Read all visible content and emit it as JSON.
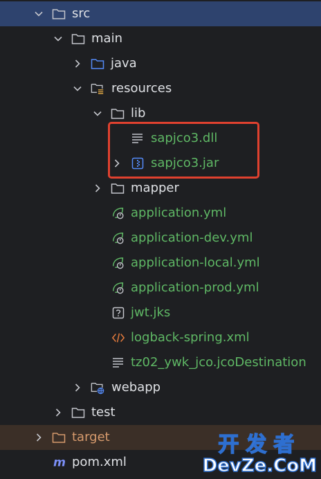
{
  "tree": {
    "src": "src",
    "main": "main",
    "java": "java",
    "resources": "resources",
    "lib": "lib",
    "dll": "sapjco3.dll",
    "jar": "sapjco3.jar",
    "mapper": "mapper",
    "app_yml": "application.yml",
    "app_dev": "application-dev.yml",
    "app_local": "application-local.yml",
    "app_prod": "application-prod.yml",
    "jwt": "jwt.jks",
    "logback": "logback-spring.xml",
    "jco_dest": "tz02_ywk_jco.jcoDestination",
    "webapp": "webapp",
    "test": "test",
    "target": "target",
    "pom": "pom.xml"
  },
  "watermark": {
    "cn": "开发者",
    "en": "DevZe.CoM"
  },
  "colors": {
    "background": "#1e1f22",
    "selected_row": "#2e436e",
    "excluded_row": "#3b2f27",
    "highlight_border": "#e0412f",
    "resource_text": "#5fb865",
    "excluded_text": "#d79b6d"
  }
}
